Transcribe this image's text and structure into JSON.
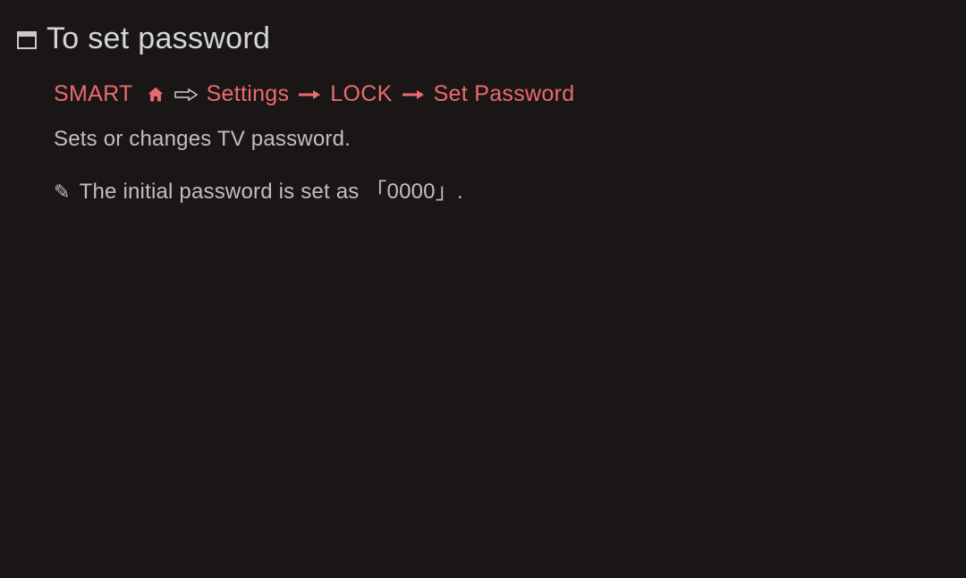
{
  "heading": "To set password",
  "breadcrumb": {
    "smart": "SMART",
    "settings": "Settings",
    "lock": "LOCK",
    "setPassword": "Set Password"
  },
  "description": "Sets or changes TV password.",
  "note": {
    "prefix": "The initial password is set as ",
    "open_bracket": "「",
    "value": "0000",
    "close_bracket": "」",
    "suffix": "."
  }
}
